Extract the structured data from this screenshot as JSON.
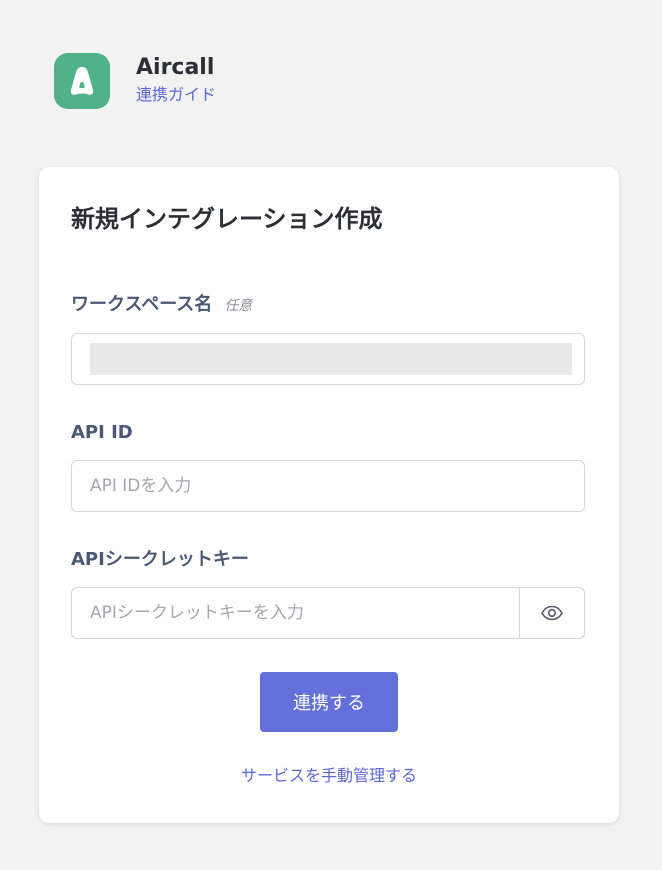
{
  "app": {
    "name": "Aircall",
    "guide_link": "連携ガイド",
    "icon": "aircall-logo-icon",
    "brand_color": "#50b286"
  },
  "form": {
    "title": "新規インテグレーション作成",
    "workspace_name": {
      "label": "ワークスペース名",
      "optional": "任意",
      "value": ""
    },
    "api_id": {
      "label": "API ID",
      "placeholder": "API IDを入力",
      "value": ""
    },
    "api_secret": {
      "label": "APIシークレットキー",
      "placeholder": "APIシークレットキーを入力",
      "value": "",
      "toggle_icon": "eye-icon"
    },
    "submit_label": "連携する",
    "manual_link": "サービスを手動管理する",
    "accent_color": "#6470da"
  }
}
